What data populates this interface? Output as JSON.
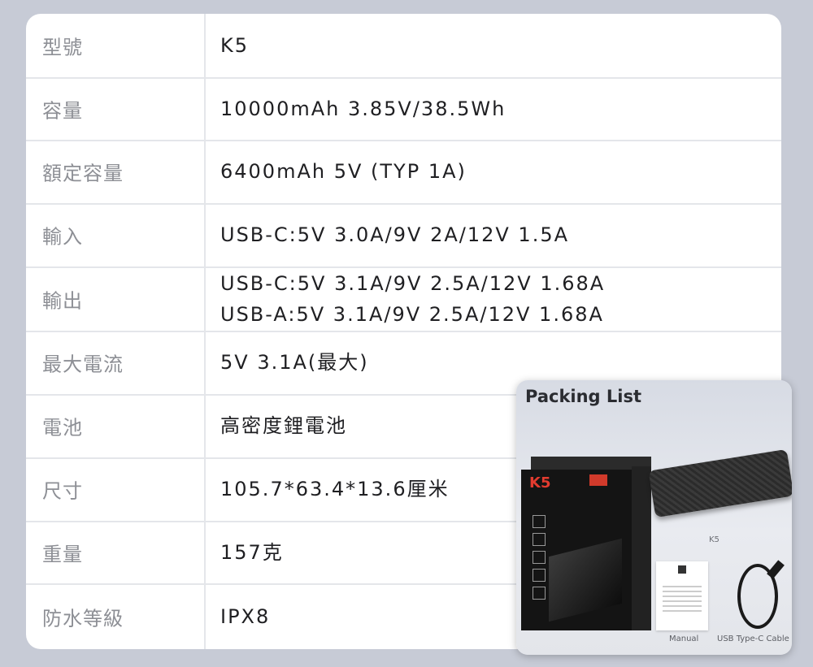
{
  "spec_rows": [
    {
      "label": "型號",
      "values": [
        "K5"
      ]
    },
    {
      "label": "容量",
      "values": [
        "10000mAh 3.85V/38.5Wh"
      ]
    },
    {
      "label": "額定容量",
      "values": [
        "6400mAh 5V (TYP 1A)"
      ]
    },
    {
      "label": "輸入",
      "values": [
        "USB-C:5V 3.0A/9V 2A/12V 1.5A"
      ]
    },
    {
      "label": "輸出",
      "values": [
        "USB-C:5V 3.1A/9V 2.5A/12V 1.68A",
        "USB-A:5V 3.1A/9V 2.5A/12V 1.68A"
      ]
    },
    {
      "label": "最大電流",
      "values": [
        "5V 3.1A(最大)"
      ]
    },
    {
      "label": "電池",
      "values": [
        "高密度鋰電池"
      ]
    },
    {
      "label": "尺寸",
      "values": [
        "105.7*63.4*13.6厘米"
      ]
    },
    {
      "label": "重量",
      "values": [
        "157克"
      ]
    },
    {
      "label": "防水等級",
      "values": [
        "IPX8"
      ]
    }
  ],
  "packing_list": {
    "title": "Packing List",
    "box_model": "K5",
    "bank_label": "K5",
    "items": [
      "Manual",
      "USB Type-C Cable"
    ]
  },
  "colors": {
    "background": "#c7cbd6",
    "card": "#ffffff",
    "label_text": "#8d8f95",
    "value_text": "#1f1f22",
    "brand_red": "#e23b2f"
  }
}
